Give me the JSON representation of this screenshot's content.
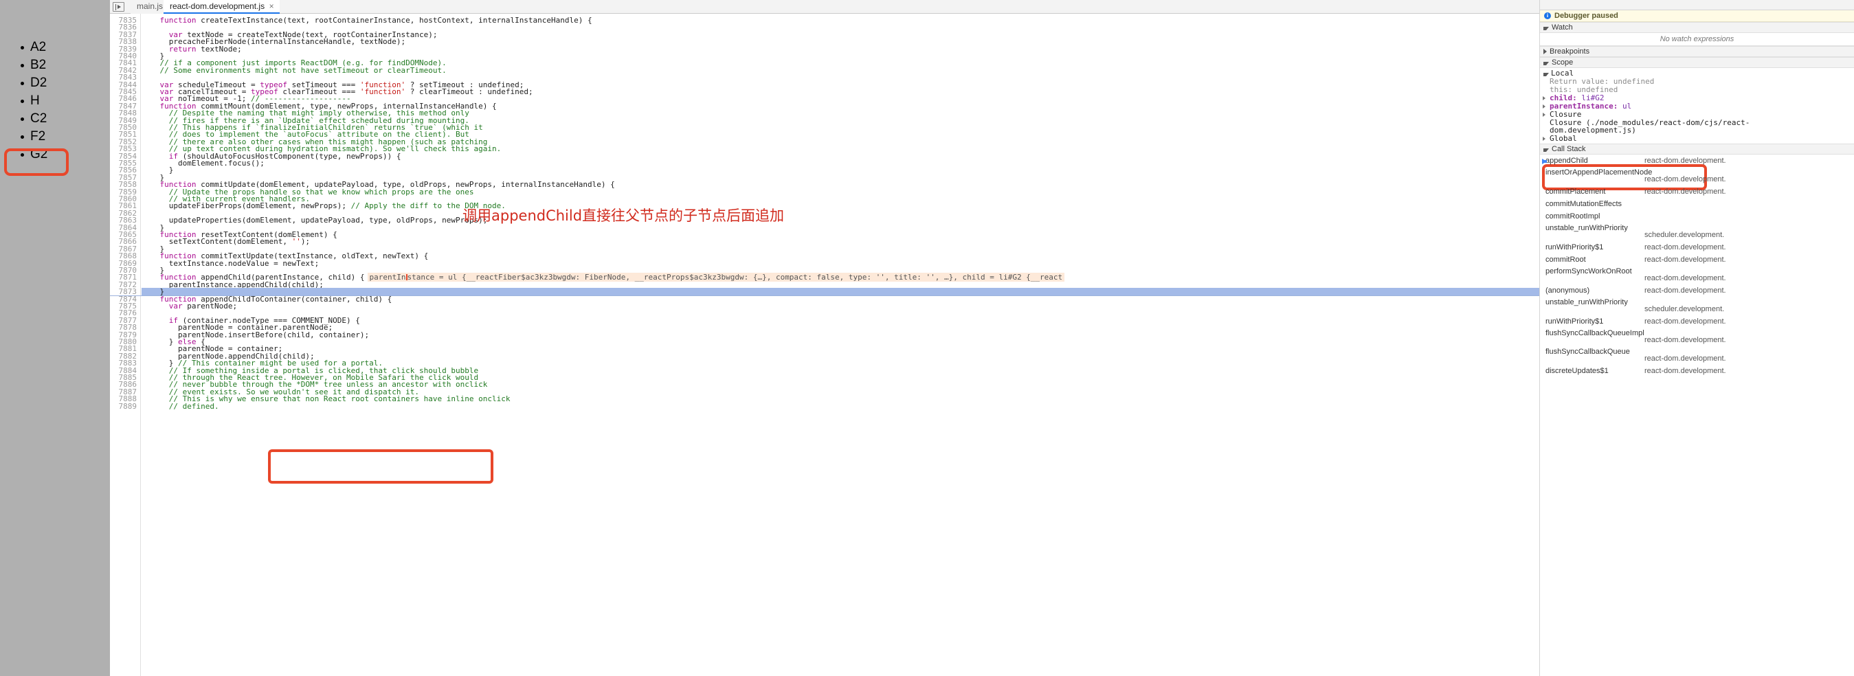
{
  "page_pane": {
    "items": [
      "A2",
      "B2",
      "D2",
      "H",
      "C2",
      "F2",
      "G2"
    ],
    "highlighted_item": "G2",
    "highlight_color": "#e8472a"
  },
  "tabs": {
    "nav_icon": "navigator-toggle-icon",
    "items": [
      {
        "label": "main.js",
        "selected": false,
        "closable": false
      },
      {
        "label": "react-dom.development.js",
        "selected": true,
        "closable": true,
        "close_label": "×"
      }
    ]
  },
  "annotation": {
    "chinese_note": "调用appendChild直接往父节点的子节点后面追加",
    "color": "#d12b1e"
  },
  "inline_hint": "parentInstance = ul {__reactFiber$ac3kz3bwgdw: FiberNode, __reactProps$ac3kz3bwgdw: {…}, compact: false, type: '', title: '', …}, child = li#G2 {__react",
  "code": {
    "first_line_number": 7835,
    "executing_line": 7873,
    "lines": [
      {
        "n": 7835,
        "indent": 2,
        "parts": [
          {
            "t": "kw",
            "s": "function "
          },
          {
            "t": "pl",
            "s": "createTextInstance(text, rootContainerInstance, hostContext, internalInstanceHandle) {"
          }
        ]
      },
      {
        "n": 7836,
        "indent": 0,
        "parts": []
      },
      {
        "n": 7837,
        "indent": 3,
        "parts": [
          {
            "t": "kw",
            "s": "var "
          },
          {
            "t": "pl",
            "s": "textNode = createTextNode(text, rootContainerInstance);"
          }
        ]
      },
      {
        "n": 7838,
        "indent": 3,
        "parts": [
          {
            "t": "pl",
            "s": "precacheFiberNode(internalInstanceHandle, textNode);"
          }
        ]
      },
      {
        "n": 7839,
        "indent": 3,
        "parts": [
          {
            "t": "kw",
            "s": "return "
          },
          {
            "t": "pl",
            "s": "textNode;"
          }
        ]
      },
      {
        "n": 7840,
        "indent": 2,
        "parts": [
          {
            "t": "pl",
            "s": "}"
          }
        ]
      },
      {
        "n": 7841,
        "indent": 2,
        "parts": [
          {
            "t": "cm",
            "s": "// if a component just imports ReactDOM (e.g. for findDOMNode)."
          }
        ]
      },
      {
        "n": 7842,
        "indent": 2,
        "parts": [
          {
            "t": "cm",
            "s": "// Some environments might not have setTimeout or clearTimeout."
          }
        ]
      },
      {
        "n": 7843,
        "indent": 0,
        "parts": []
      },
      {
        "n": 7844,
        "indent": 2,
        "parts": [
          {
            "t": "kw",
            "s": "var "
          },
          {
            "t": "pl",
            "s": "scheduleTimeout = "
          },
          {
            "t": "kw",
            "s": "typeof "
          },
          {
            "t": "pl",
            "s": "setTimeout === "
          },
          {
            "t": "st",
            "s": "'function'"
          },
          {
            "t": "pl",
            "s": " ? setTimeout : undefined;"
          }
        ]
      },
      {
        "n": 7845,
        "indent": 2,
        "parts": [
          {
            "t": "kw",
            "s": "var "
          },
          {
            "t": "pl",
            "s": "cancelTimeout = "
          },
          {
            "t": "kw",
            "s": "typeof "
          },
          {
            "t": "pl",
            "s": "clearTimeout === "
          },
          {
            "t": "st",
            "s": "'function'"
          },
          {
            "t": "pl",
            "s": " ? clearTimeout : undefined;"
          }
        ]
      },
      {
        "n": 7846,
        "indent": 2,
        "parts": [
          {
            "t": "kw",
            "s": "var "
          },
          {
            "t": "pl",
            "s": "noTimeout = -1; "
          },
          {
            "t": "cm",
            "s": "// -------------------"
          }
        ]
      },
      {
        "n": 7847,
        "indent": 2,
        "parts": [
          {
            "t": "kw",
            "s": "function "
          },
          {
            "t": "pl",
            "s": "commitMount(domElement, type, newProps, internalInstanceHandle) {"
          }
        ]
      },
      {
        "n": 7848,
        "indent": 3,
        "parts": [
          {
            "t": "cm",
            "s": "// Despite the naming that might imply otherwise, this method only"
          }
        ]
      },
      {
        "n": 7849,
        "indent": 3,
        "parts": [
          {
            "t": "cm",
            "s": "// fires if there is an `Update` effect scheduled during mounting."
          }
        ]
      },
      {
        "n": 7850,
        "indent": 3,
        "parts": [
          {
            "t": "cm",
            "s": "// This happens if `finalizeInitialChildren` returns `true` (which it"
          }
        ]
      },
      {
        "n": 7851,
        "indent": 3,
        "parts": [
          {
            "t": "cm",
            "s": "// does to implement the `autoFocus` attribute on the client). But"
          }
        ]
      },
      {
        "n": 7852,
        "indent": 3,
        "parts": [
          {
            "t": "cm",
            "s": "// there are also other cases when this might happen (such as patching"
          }
        ]
      },
      {
        "n": 7853,
        "indent": 3,
        "parts": [
          {
            "t": "cm",
            "s": "// up text content during hydration mismatch). So we'll check this again."
          }
        ]
      },
      {
        "n": 7854,
        "indent": 3,
        "parts": [
          {
            "t": "kw",
            "s": "if "
          },
          {
            "t": "pl",
            "s": "(shouldAutoFocusHostComponent(type, newProps)) {"
          }
        ]
      },
      {
        "n": 7855,
        "indent": 4,
        "parts": [
          {
            "t": "pl",
            "s": "domElement.focus();"
          }
        ]
      },
      {
        "n": 7856,
        "indent": 3,
        "parts": [
          {
            "t": "pl",
            "s": "}"
          }
        ]
      },
      {
        "n": 7857,
        "indent": 2,
        "parts": [
          {
            "t": "pl",
            "s": "}"
          }
        ]
      },
      {
        "n": 7858,
        "indent": 2,
        "parts": [
          {
            "t": "kw",
            "s": "function "
          },
          {
            "t": "pl",
            "s": "commitUpdate(domElement, updatePayload, type, oldProps, newProps, internalInstanceHandle) {"
          }
        ]
      },
      {
        "n": 7859,
        "indent": 3,
        "parts": [
          {
            "t": "cm",
            "s": "// Update the props handle so that we know which props are the ones"
          }
        ]
      },
      {
        "n": 7860,
        "indent": 3,
        "parts": [
          {
            "t": "cm",
            "s": "// with current event handlers."
          }
        ]
      },
      {
        "n": 7861,
        "indent": 3,
        "parts": [
          {
            "t": "pl",
            "s": "updateFiberProps(domElement, newProps); "
          },
          {
            "t": "cm",
            "s": "// Apply the diff to the DOM node."
          }
        ]
      },
      {
        "n": 7862,
        "indent": 0,
        "parts": []
      },
      {
        "n": 7863,
        "indent": 3,
        "parts": [
          {
            "t": "pl",
            "s": "updateProperties(domElement, updatePayload, type, oldProps, newProps);"
          }
        ]
      },
      {
        "n": 7864,
        "indent": 2,
        "parts": [
          {
            "t": "pl",
            "s": "}"
          }
        ]
      },
      {
        "n": 7865,
        "indent": 2,
        "parts": [
          {
            "t": "kw",
            "s": "function "
          },
          {
            "t": "pl",
            "s": "resetTextContent(domElement) {"
          }
        ]
      },
      {
        "n": 7866,
        "indent": 3,
        "parts": [
          {
            "t": "pl",
            "s": "setTextContent(domElement, "
          },
          {
            "t": "st",
            "s": "''"
          },
          {
            "t": "pl",
            "s": ");"
          }
        ]
      },
      {
        "n": 7867,
        "indent": 2,
        "parts": [
          {
            "t": "pl",
            "s": "}"
          }
        ]
      },
      {
        "n": 7868,
        "indent": 2,
        "parts": [
          {
            "t": "kw",
            "s": "function "
          },
          {
            "t": "pl",
            "s": "commitTextUpdate(textInstance, oldText, newText) {"
          }
        ]
      },
      {
        "n": 7869,
        "indent": 3,
        "parts": [
          {
            "t": "pl",
            "s": "textInstance.nodeValue = newText;"
          }
        ]
      },
      {
        "n": 7870,
        "indent": 2,
        "parts": [
          {
            "t": "pl",
            "s": "}"
          }
        ]
      },
      {
        "n": 7871,
        "indent": 2,
        "parts": [
          {
            "t": "kw",
            "s": "function "
          },
          {
            "t": "pl",
            "s": "appendChild(parentInstance, child) {"
          }
        ],
        "hint": true
      },
      {
        "n": 7872,
        "indent": 3,
        "parts": [
          {
            "t": "pl",
            "s": "parentInstance.appendChild(child);"
          }
        ]
      },
      {
        "n": 7873,
        "indent": 2,
        "parts": [
          {
            "t": "pl",
            "s": "}"
          }
        ],
        "executing": true
      },
      {
        "n": 7874,
        "indent": 2,
        "parts": [
          {
            "t": "kw",
            "s": "function "
          },
          {
            "t": "pl",
            "s": "appendChildToContainer(container, child) {"
          }
        ]
      },
      {
        "n": 7875,
        "indent": 3,
        "parts": [
          {
            "t": "kw",
            "s": "var "
          },
          {
            "t": "pl",
            "s": "parentNode;"
          }
        ]
      },
      {
        "n": 7876,
        "indent": 0,
        "parts": []
      },
      {
        "n": 7877,
        "indent": 3,
        "parts": [
          {
            "t": "kw",
            "s": "if "
          },
          {
            "t": "pl",
            "s": "(container.nodeType === COMMENT_NODE) {"
          }
        ]
      },
      {
        "n": 7878,
        "indent": 4,
        "parts": [
          {
            "t": "pl",
            "s": "parentNode = container.parentNode;"
          }
        ]
      },
      {
        "n": 7879,
        "indent": 4,
        "parts": [
          {
            "t": "pl",
            "s": "parentNode.insertBefore(child, container);"
          }
        ]
      },
      {
        "n": 7880,
        "indent": 3,
        "parts": [
          {
            "t": "pl",
            "s": "} "
          },
          {
            "t": "kw",
            "s": "else "
          },
          {
            "t": "pl",
            "s": "{"
          }
        ]
      },
      {
        "n": 7881,
        "indent": 4,
        "parts": [
          {
            "t": "pl",
            "s": "parentNode = container;"
          }
        ]
      },
      {
        "n": 7882,
        "indent": 4,
        "parts": [
          {
            "t": "pl",
            "s": "parentNode.appendChild(child);"
          }
        ]
      },
      {
        "n": 7883,
        "indent": 3,
        "parts": [
          {
            "t": "pl",
            "s": "} "
          },
          {
            "t": "cm",
            "s": "// This container might be used for a portal."
          }
        ]
      },
      {
        "n": 7884,
        "indent": 3,
        "parts": [
          {
            "t": "cm",
            "s": "// If something inside a portal is clicked, that click should bubble"
          }
        ]
      },
      {
        "n": 7885,
        "indent": 3,
        "parts": [
          {
            "t": "cm",
            "s": "// through the React tree. However, on Mobile Safari the click would"
          }
        ]
      },
      {
        "n": 7886,
        "indent": 3,
        "parts": [
          {
            "t": "cm",
            "s": "// never bubble through the *DOM* tree unless an ancestor with onclick"
          }
        ]
      },
      {
        "n": 7887,
        "indent": 3,
        "parts": [
          {
            "t": "cm",
            "s": "// event exists. So we wouldn't see it and dispatch it."
          }
        ]
      },
      {
        "n": 7888,
        "indent": 3,
        "parts": [
          {
            "t": "cm",
            "s": "// This is why we ensure that non React root containers have inline onclick"
          }
        ]
      },
      {
        "n": 7889,
        "indent": 3,
        "parts": [
          {
            "t": "cm",
            "s": "// defined."
          }
        ]
      }
    ]
  },
  "debugger": {
    "paused_text": "Debugger paused",
    "info_icon": "info-icon",
    "watch": {
      "title": "Watch",
      "empty_text": "No watch expressions",
      "expanded": true
    },
    "breakpoints": {
      "title": "Breakpoints",
      "expanded": false
    },
    "scope": {
      "title": "Scope",
      "expanded": true,
      "local_label": "Local",
      "local_rows": [
        {
          "name": "Return value:",
          "value": "undefined",
          "style": "gray",
          "expandable": false
        },
        {
          "name": "this:",
          "value": "undefined",
          "style": "gray",
          "expandable": false
        },
        {
          "name": "child:",
          "value": "li#G2",
          "style": "prop",
          "expandable": true
        },
        {
          "name": "parentInstance:",
          "value": "ul",
          "style": "prop",
          "expandable": true
        }
      ],
      "closure_label": "Closure (./node_modules/react-dom/cjs/react-dom.development.js)",
      "global_label": "Global"
    },
    "call_stack": {
      "title": "Call Stack",
      "expanded": true,
      "frames": [
        {
          "fn": "appendChild",
          "loc": "react-dom.development.",
          "current": true
        },
        {
          "fn": "insertOrAppendPlacementNode",
          "loc": "react-dom.development.",
          "loc_below": true
        },
        {
          "fn": "commitPlacement",
          "loc": "react-dom.development."
        },
        {
          "fn": "commitMutationEffects",
          "loc": ""
        },
        {
          "fn": "commitRootImpl",
          "loc": ""
        },
        {
          "fn": "unstable_runWithPriority",
          "loc": "scheduler.development.",
          "loc_below": true
        },
        {
          "fn": "runWithPriority$1",
          "loc": "react-dom.development."
        },
        {
          "fn": "commitRoot",
          "loc": "react-dom.development."
        },
        {
          "fn": "performSyncWorkOnRoot",
          "loc": "react-dom.development.",
          "loc_below": true
        },
        {
          "fn": "(anonymous)",
          "loc": "react-dom.development."
        },
        {
          "fn": "unstable_runWithPriority",
          "loc": "scheduler.development.",
          "loc_below": true
        },
        {
          "fn": "runWithPriority$1",
          "loc": "react-dom.development."
        },
        {
          "fn": "flushSyncCallbackQueueImpl",
          "loc": "react-dom.development.",
          "loc_below": true
        },
        {
          "fn": "flushSyncCallbackQueue",
          "loc": "react-dom.development.",
          "loc_below": true
        },
        {
          "fn": "discreteUpdates$1",
          "loc": "react-dom.development."
        }
      ]
    }
  }
}
